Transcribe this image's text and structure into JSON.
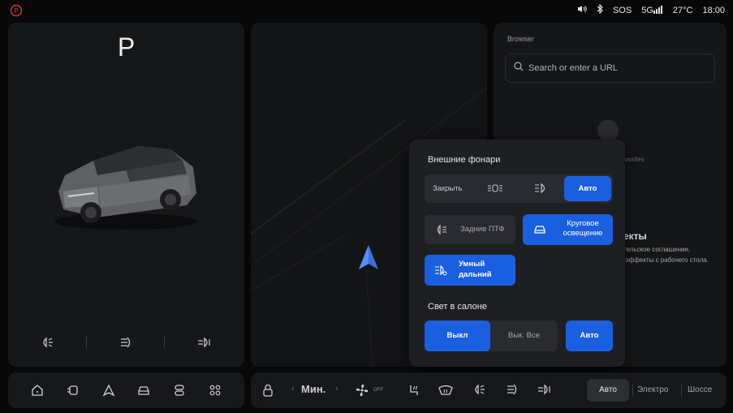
{
  "status_bar": {
    "items": [
      "SOS",
      "5G",
      "27°C",
      "18:00"
    ],
    "brake_label": "(P)"
  },
  "left_panel": {
    "gear": "P",
    "icons": [
      "headlight-icon",
      "low-beam-icon",
      "fog-light-icon"
    ]
  },
  "browser": {
    "title": "Browser",
    "search_placeholder": "Search or enter a URL",
    "favorites_fragment": "vorites",
    "heading_fragment": "екты",
    "desc_line1": "тельское соглашение,",
    "desc_line2": "-эффекты с рабочего стола."
  },
  "lights_popup": {
    "title": "Внешние фонари",
    "mode_off": "Закрыть",
    "mode_auto": "Авто",
    "rear_fog_label": "Задние ПТФ",
    "surround_line1": "Круговое",
    "surround_line2": "освещение",
    "smart_line1": "Умный",
    "smart_line2": "дальний",
    "cabin_title": "Свет в салоне",
    "cabin_off": "Выкл",
    "cabin_all_off": "Вык. Все",
    "cabin_auto": "Авто"
  },
  "dock": {
    "left_icons": [
      "home-icon",
      "car-screen-icon",
      "navigation-icon",
      "car-icon",
      "media-icon",
      "apps-icon"
    ],
    "fan_level": "Мин.",
    "fan_state": "OFF",
    "drive_modes": [
      "Авто",
      "Электро",
      "Шоссе"
    ],
    "active_drive_mode": "Авто"
  },
  "colors": {
    "accent": "#1a5fe0",
    "brake_red": "#e0352b",
    "nav_arrow": "#3b6fe0"
  }
}
